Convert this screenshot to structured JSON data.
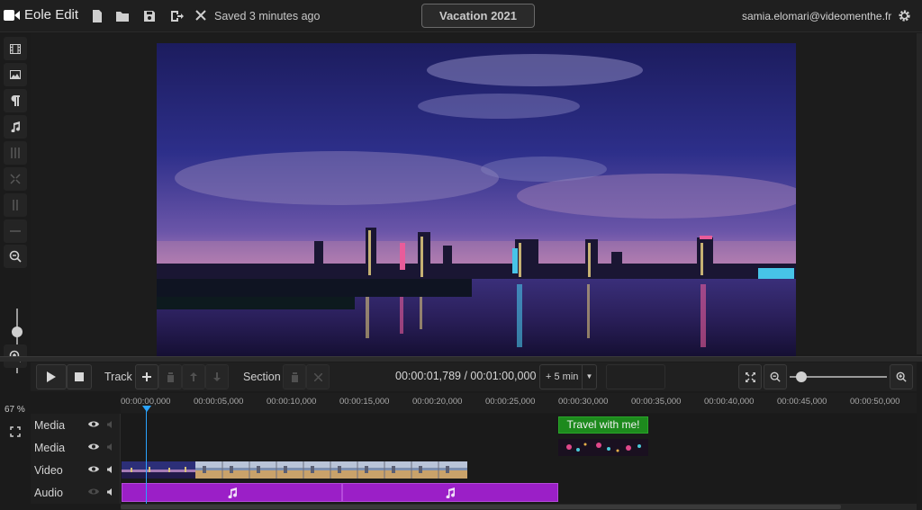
{
  "app": {
    "name": "Eole Edit",
    "save_status": "Saved 3 minutes ago",
    "project_title": "Vacation 2021",
    "user_email": "samia.elomari@videomenthe.fr"
  },
  "toolbar": {
    "icons": [
      "new-file-icon",
      "open-folder-icon",
      "save-icon",
      "export-icon",
      "close-icon"
    ]
  },
  "left_tools": {
    "icons": [
      "film-icon",
      "image-icon",
      "paragraph-icon",
      "music-icon",
      "split-icon",
      "fit-icon",
      "align-icon",
      "separator-icon",
      "zoom-out-icon",
      "zoom-in-icon",
      "fullscreen-icon"
    ],
    "zoom_percent": "67 %"
  },
  "controls": {
    "track_label": "Track",
    "section_label": "Section",
    "timecode": "00:00:01,789 / 00:01:00,000",
    "add_time_label": "+ 5 min"
  },
  "ruler": {
    "ticks": [
      "00:00:00,000",
      "00:00:05,000",
      "00:00:10,000",
      "00:00:15,000",
      "00:00:20,000",
      "00:00:25,000",
      "00:00:30,000",
      "00:00:35,000",
      "00:00:40,000",
      "00:00:45,000",
      "00:00:50,000"
    ]
  },
  "tracks": [
    {
      "name": "Media"
    },
    {
      "name": "Media"
    },
    {
      "name": "Video"
    },
    {
      "name": "Audio"
    }
  ],
  "clips": {
    "text_clip": "Travel with me!"
  },
  "colors": {
    "accent_blue": "#2aa3ff",
    "text_clip_green": "#1d8a1d",
    "audio_purple": "#9b1fc7"
  }
}
